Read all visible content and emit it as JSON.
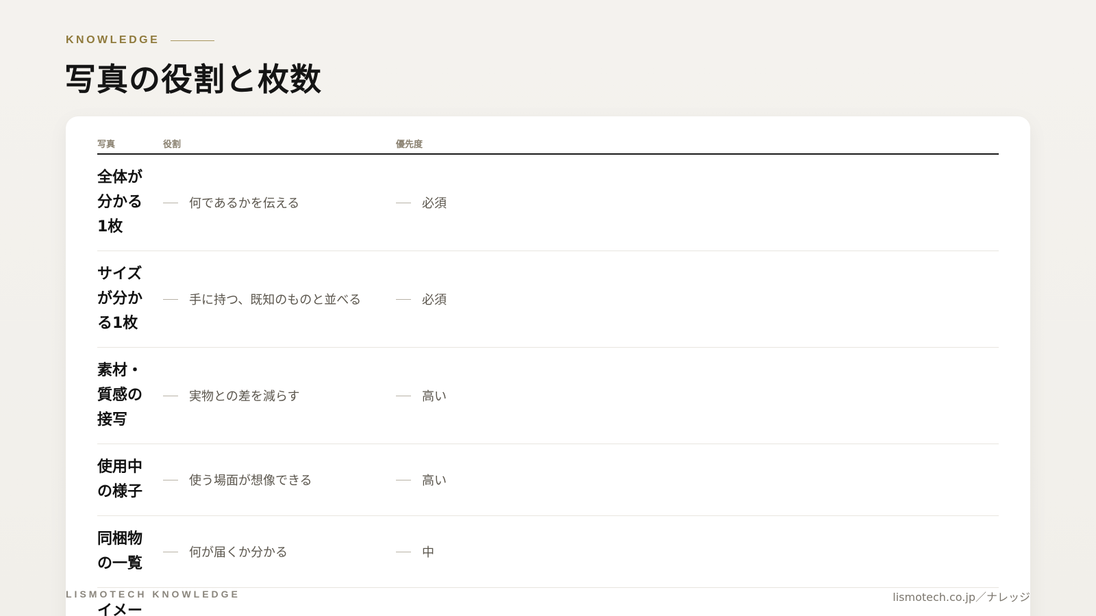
{
  "header": {
    "eyebrow": "KNOWLEDGE",
    "title": "写真の役割と枚数"
  },
  "table": {
    "columns": [
      "写真",
      "役割",
      "優先度"
    ],
    "rows": [
      {
        "photo": "全体が\n分かる\n1枚",
        "role": "何であるかを伝える",
        "priority": "必須"
      },
      {
        "photo": "サイズ\nが分か\nる1枚",
        "role": "手に持つ、既知のものと並べる",
        "priority": "必須"
      },
      {
        "photo": "素材・\n質感の\n接写",
        "role": "実物との差を減らす",
        "priority": "高い"
      },
      {
        "photo": "使用中\nの様子",
        "role": "使う場面が想像できる",
        "priority": "高い"
      },
      {
        "photo": "同梱物\nの一覧",
        "role": "何が届くか分かる",
        "priority": "中"
      },
      {
        "photo": "イメー",
        "role": "",
        "priority": ""
      }
    ]
  },
  "footer": {
    "brand": "LISMOTECH KNOWLEDGE",
    "url": "lismotech.co.jp／ナレッジ"
  },
  "colors": {
    "accent": "#8f7a3c",
    "background": "#f3f1ed",
    "card": "#ffffff",
    "text": "#151515"
  }
}
